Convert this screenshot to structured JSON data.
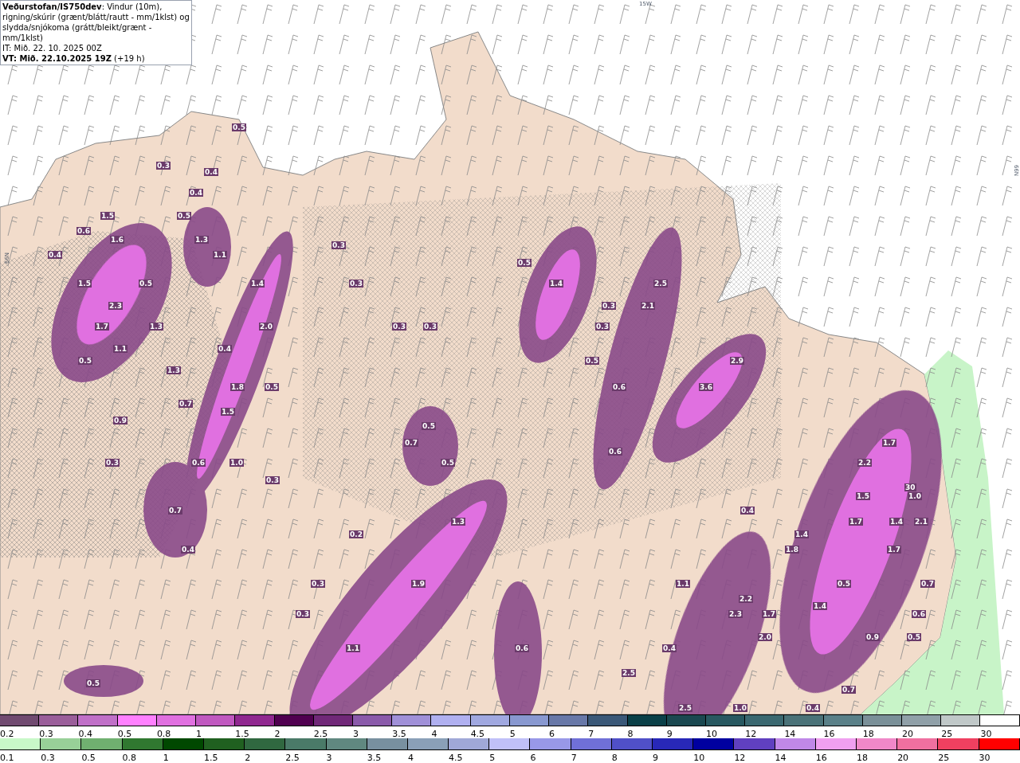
{
  "header": {
    "description": "**Veðurstofan/IS750dev**: Vindur (10m), rigning/skúrir (grænt/blátt/rautt - mm/1klst) og slydda/snjókoma (grátt/bleikt/grænt - mm/1klst)",
    "init_time": "IT: Mið. 22. 10. 2025 00Z",
    "valid_time": "**VT: Mið. 22.10.2025 19Z** (+19 h)"
  },
  "map": {
    "grid_labels": [
      "15W",
      "66N",
      "66N"
    ],
    "values": [
      "0.5",
      "0.3",
      "0.4",
      "0.4",
      "1.5",
      "0.5",
      "0.6",
      "1.6",
      "1.3",
      "0.3",
      "0.4",
      "1.1",
      "0.5",
      "1.5",
      "0.5",
      "1.4",
      "0.3",
      "1.4",
      "2.5",
      "2.3",
      "0.3",
      "2.1",
      "1.7",
      "1.3",
      "2.0",
      "0.3",
      "0.3",
      "0.3",
      "1.1",
      "0.4",
      "0.5",
      "0.5",
      "2.9",
      "1.3",
      "1.8",
      "0.5",
      "0.6",
      "3.6",
      "0.7",
      "1.5",
      "0.9",
      "0.5",
      "0.7",
      "1.7",
      "0.6",
      "0.3",
      "0.6",
      "1.0",
      "0.5",
      "2.2",
      "0.3",
      "30",
      "1.5",
      "1.0",
      "0.7",
      "0.4",
      "1.3",
      "1.7",
      "1.4",
      "2.1",
      "0.2",
      "1.4",
      "0.4",
      "1.8",
      "1.7",
      "0.3",
      "1.9",
      "1.1",
      "0.5",
      "0.7",
      "2.2",
      "1.4",
      "0.3",
      "2.3",
      "1.7",
      "0.6",
      "2.0",
      "0.9",
      "0.5",
      "1.1",
      "0.6",
      "0.4",
      "2.5",
      "0.5",
      "0.7",
      "2.5",
      "1.0",
      "0.4"
    ]
  },
  "legends": [
    {
      "kind": "snow",
      "steps": [
        {
          "label": "0.2",
          "color": "#704a70"
        },
        {
          "label": "0.3",
          "color": "#9a5e9a"
        },
        {
          "label": "0.4",
          "color": "#c070c8"
        },
        {
          "label": "0.5",
          "color": "#ff80ff"
        },
        {
          "label": "0.8",
          "color": "#e070e0"
        },
        {
          "label": "1",
          "color": "#c058c0"
        },
        {
          "label": "1.5",
          "color": "#902890"
        },
        {
          "label": "2",
          "color": "#500050"
        },
        {
          "label": "2.5",
          "color": "#702878"
        },
        {
          "label": "3",
          "color": "#8a5aaa"
        },
        {
          "label": "3.5",
          "color": "#a090d8"
        },
        {
          "label": "4",
          "color": "#b0b0f0"
        },
        {
          "label": "4.5",
          "color": "#a0a8e0"
        },
        {
          "label": "5",
          "color": "#8898d0"
        },
        {
          "label": "6",
          "color": "#6878a8"
        },
        {
          "label": "7",
          "color": "#3a5878"
        },
        {
          "label": "8",
          "color": "#0a4048"
        },
        {
          "label": "9",
          "color": "#1a4850"
        },
        {
          "label": "10",
          "color": "#285860"
        },
        {
          "label": "12",
          "color": "#3a6870"
        },
        {
          "label": "14",
          "color": "#4a7278"
        },
        {
          "label": "16",
          "color": "#5a8088"
        },
        {
          "label": "18",
          "color": "#7a9098"
        },
        {
          "label": "20",
          "color": "#90a0a8"
        },
        {
          "label": "25",
          "color": "#c0c8c8"
        },
        {
          "label": "30",
          "color": "#ffffff"
        }
      ]
    },
    {
      "kind": "rain",
      "steps": [
        {
          "label": "0.1",
          "color": "#c8f8c8"
        },
        {
          "label": "0.3",
          "color": "#98d098"
        },
        {
          "label": "0.5",
          "color": "#70b070"
        },
        {
          "label": "0.8",
          "color": "#307830"
        },
        {
          "label": "1",
          "color": "#004800"
        },
        {
          "label": "1.5",
          "color": "#206020"
        },
        {
          "label": "2",
          "color": "#306840"
        },
        {
          "label": "2.5",
          "color": "#4a7a68"
        },
        {
          "label": "3",
          "color": "#608880"
        },
        {
          "label": "3.5",
          "color": "#7890a0"
        },
        {
          "label": "4",
          "color": "#8aa0b8"
        },
        {
          "label": "4.5",
          "color": "#a0a8d8"
        },
        {
          "label": "5",
          "color": "#c0c0f8"
        },
        {
          "label": "6",
          "color": "#9898e8"
        },
        {
          "label": "7",
          "color": "#7070d8"
        },
        {
          "label": "8",
          "color": "#5050c8"
        },
        {
          "label": "9",
          "color": "#2828b8"
        },
        {
          "label": "10",
          "color": "#0000a0"
        },
        {
          "label": "12",
          "color": "#6040c0"
        },
        {
          "label": "14",
          "color": "#c088e8"
        },
        {
          "label": "16",
          "color": "#f0a0f0"
        },
        {
          "label": "18",
          "color": "#f088c8"
        },
        {
          "label": "20",
          "color": "#f070a0"
        },
        {
          "label": "25",
          "color": "#f04060"
        },
        {
          "label": "30",
          "color": "#ff0000"
        }
      ]
    }
  ]
}
